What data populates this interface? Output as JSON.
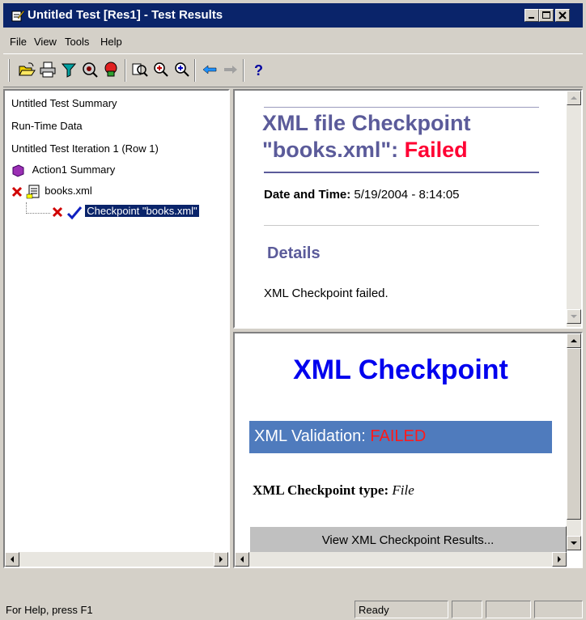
{
  "window": {
    "title": "Untitled Test [Res1] - Test Results",
    "controls": [
      "minimize",
      "maximize",
      "close"
    ]
  },
  "menu": {
    "file": "File",
    "view": "View",
    "tools": "Tools",
    "help": "Help"
  },
  "toolbar_icons": [
    "open-icon",
    "print-icon",
    "filter-icon",
    "find-icon",
    "go-to-node-icon",
    "zoom-icon",
    "zoom-in-icon",
    "zoom-out-icon",
    "back-icon",
    "forward-icon",
    "help-icon"
  ],
  "tree": {
    "items": [
      {
        "label": "Untitled Test Summary"
      },
      {
        "label": "Run-Time Data"
      },
      {
        "label": "Untitled Test Iteration 1 (Row 1)"
      },
      {
        "label": "Action1 Summary"
      },
      {
        "label": "books.xml"
      },
      {
        "label": "Checkpoint \"books.xml\""
      }
    ]
  },
  "summary": {
    "heading_prefix": "XML file Checkpoint",
    "heading_name": "\"books.xml\":",
    "heading_status": "Failed",
    "date_label": "Date and Time:",
    "date_value": "5/19/2004 - 8:14:05",
    "details_heading": "Details",
    "details_text": "XML Checkpoint failed."
  },
  "checkpoint": {
    "title": "XML Checkpoint",
    "validation_label": "XML Validation:",
    "validation_status": "FAILED",
    "type_label": "XML Checkpoint type:",
    "type_value": "File",
    "view_button": "View XML Checkpoint Results..."
  },
  "status": {
    "help": "For Help, press F1",
    "state": "Ready"
  },
  "colors": {
    "title_bar": "#0a246a",
    "heading_purple": "#5b5b9a",
    "failed_red": "#ff0033",
    "checkpoint_blue": "#0000ee",
    "validation_bar": "#4f7bbd"
  }
}
